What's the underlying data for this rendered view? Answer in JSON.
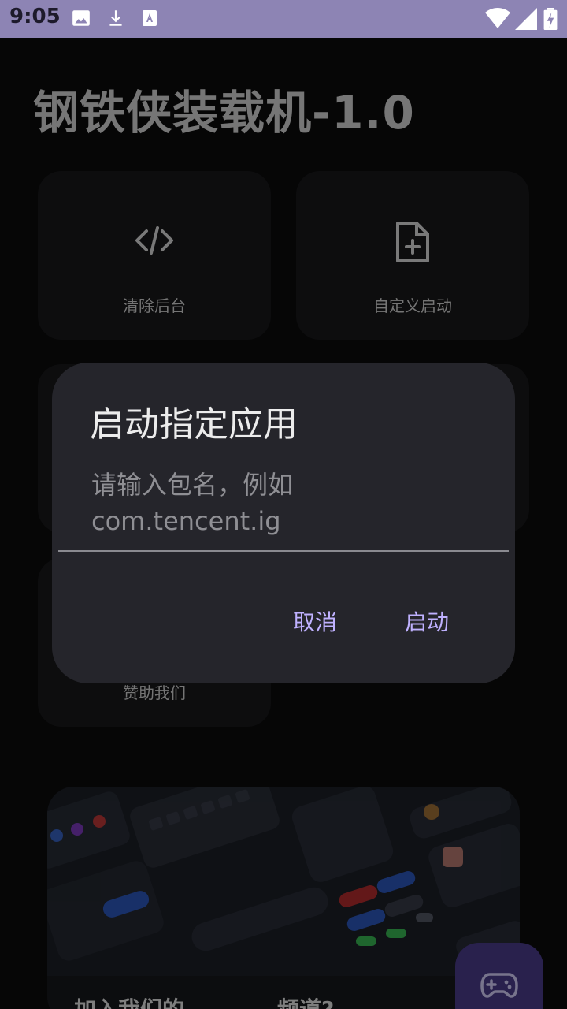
{
  "status_bar": {
    "time": "9:05",
    "icons": [
      "image-icon",
      "download-icon",
      "font-icon",
      "wifi-icon",
      "signal-icon",
      "battery-charging-icon"
    ]
  },
  "app": {
    "title": "钢铁侠装载机-1.0"
  },
  "cards": [
    {
      "label": "清除后台",
      "icon": "code-icon"
    },
    {
      "label": "自定义启动",
      "icon": "file-plus-icon"
    },
    {
      "label": "赞助我们",
      "icon": ""
    }
  ],
  "dialog": {
    "title": "启动指定应用",
    "input": {
      "value": "",
      "placeholder": "请输入包名，例如com.tencent.ig"
    },
    "cancel_label": "取消",
    "confirm_label": "启动"
  },
  "banner": {
    "texts": [
      "加入我们的",
      "频道?"
    ]
  },
  "fab": {
    "icon": "gamepad-icon"
  },
  "colors": {
    "status_bar": "#8d84b4",
    "dialog_bg": "#25252b",
    "accent": "#bfb1ff",
    "fab": "#4b3d8c"
  }
}
